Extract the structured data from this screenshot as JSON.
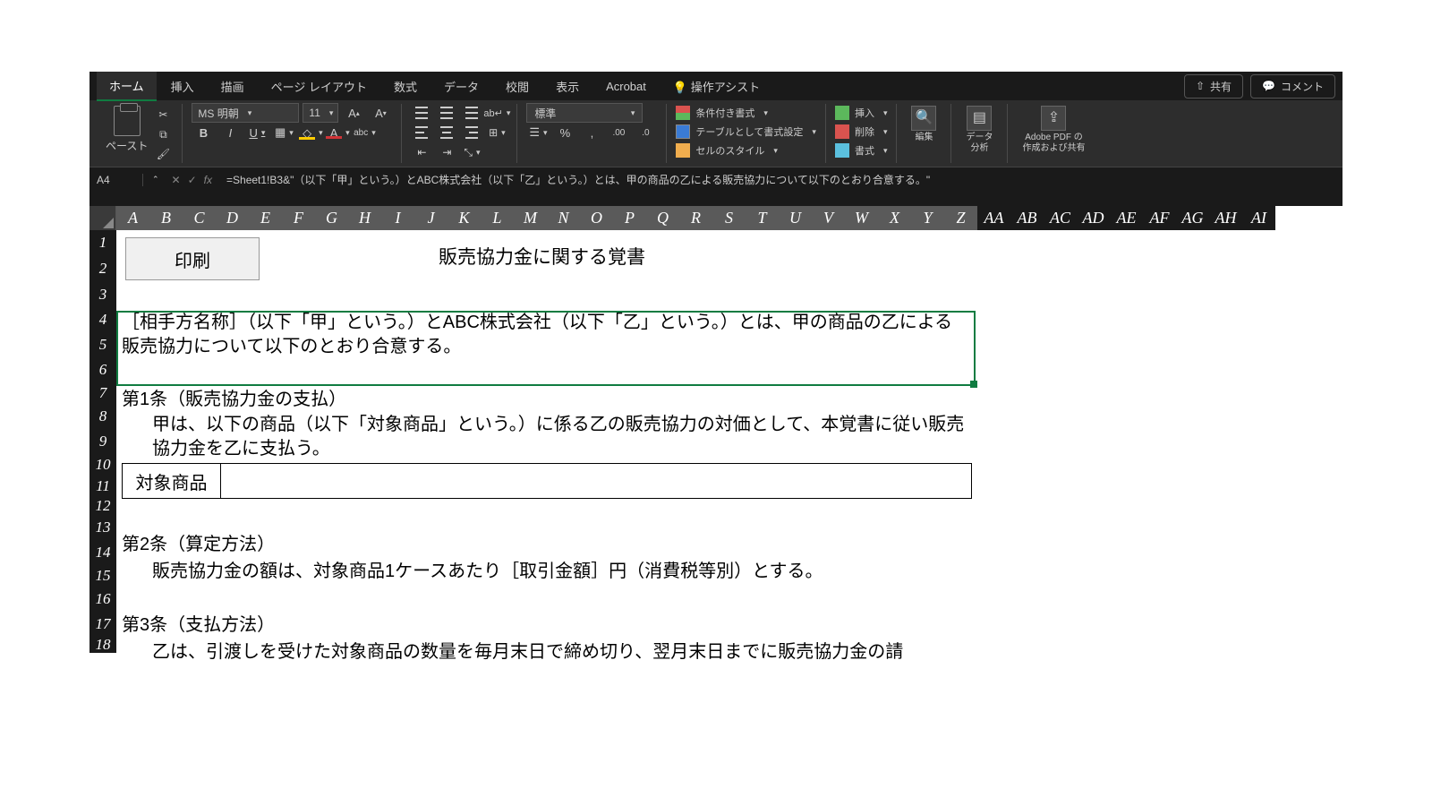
{
  "tabs": {
    "home": "ホーム",
    "insert": "挿入",
    "draw": "描画",
    "layout": "ページ レイアウト",
    "formulas": "数式",
    "data": "データ",
    "review": "校閲",
    "view": "表示",
    "acrobat": "Acrobat",
    "tell_me": "操作アシスト"
  },
  "share": "共有",
  "comments": "コメント",
  "clipboard": {
    "paste": "ペースト"
  },
  "font": {
    "name": "MS 明朝",
    "size": "11"
  },
  "number_format": "標準",
  "styles": {
    "cond": "条件付き書式",
    "table": "テーブルとして書式設定",
    "cell": "セルのスタイル"
  },
  "cells_group": {
    "insert": "挿入",
    "delete": "削除",
    "format": "書式"
  },
  "editing": "編集",
  "analysis": "データ\n分析",
  "adobe": "Adobe PDF の\n作成および共有",
  "namebox": "A4",
  "fx": "fx",
  "formula": "=Sheet1!B3&\"（以下「甲」という。）とABC株式会社（以下「乙」という。）とは、甲の商品の乙による販売協力について以下のとおり合意する。\"",
  "columns": [
    "A",
    "B",
    "C",
    "D",
    "E",
    "F",
    "G",
    "H",
    "I",
    "J",
    "K",
    "L",
    "M",
    "N",
    "O",
    "P",
    "Q",
    "R",
    "S",
    "T",
    "U",
    "V",
    "W",
    "X",
    "Y",
    "Z",
    "AA",
    "AB",
    "AC",
    "AD",
    "AE",
    "AF",
    "AG",
    "AH",
    "AI"
  ],
  "rows": [
    1,
    2,
    3,
    4,
    5,
    6,
    7,
    8,
    9,
    10,
    11,
    12,
    13,
    14,
    15,
    16,
    17,
    18
  ],
  "doc": {
    "title": "販売協力金に関する覚書",
    "print_btn": "印刷",
    "para1": "［相手方名称］（以下「甲」という。）とABC株式会社（以下「乙」という。）とは、甲の商品の乙による販売協力について以下のとおり合意する。",
    "art1_h": "第1条（販売協力金の支払）",
    "art1_b": "甲は、以下の商品（以下「対象商品」という。）に係る乙の販売協力の対価として、本覚書に従い販売協力金を乙に支払う。",
    "table_label": "対象商品",
    "art2_h": "第2条（算定方法）",
    "art2_b": "販売協力金の額は、対象商品1ケースあたり［取引金額］円（消費税等別）とする。",
    "art3_h": "第3条（支払方法）",
    "art3_b": "乙は、引渡しを受けた対象商品の数量を毎月末日で締め切り、翌月末日までに販売協力金の請"
  }
}
